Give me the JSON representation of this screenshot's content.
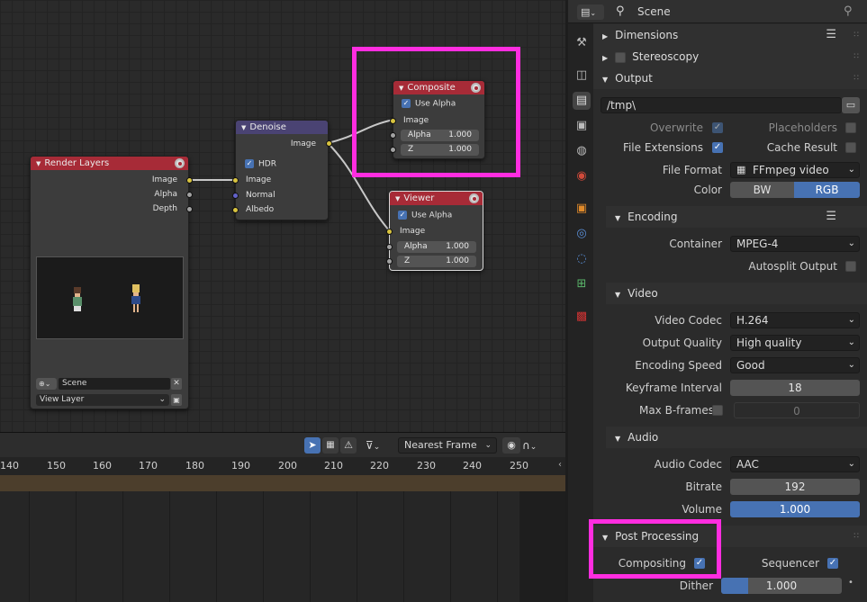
{
  "nodes": {
    "render_layers": {
      "title": "Render Layers",
      "outputs": [
        "Image",
        "Alpha",
        "Depth"
      ],
      "scene_field": "Scene",
      "layer_field": "View Layer"
    },
    "denoise": {
      "title": "Denoise",
      "output": "Image",
      "hdr_label": "HDR",
      "inputs": [
        "Image",
        "Normal",
        "Albedo"
      ]
    },
    "composite": {
      "title": "Composite",
      "use_alpha": "Use Alpha",
      "image": "Image",
      "alpha_label": "Alpha",
      "alpha_value": "1.000",
      "z_label": "Z",
      "z_value": "1.000"
    },
    "viewer": {
      "title": "Viewer",
      "use_alpha": "Use Alpha",
      "image": "Image",
      "alpha_label": "Alpha",
      "alpha_value": "1.000",
      "z_label": "Z",
      "z_value": "1.000"
    }
  },
  "timeline": {
    "interpolation": "Nearest Frame",
    "ticks": [
      "140",
      "150",
      "160",
      "170",
      "180",
      "190",
      "200",
      "210",
      "220",
      "230",
      "240",
      "250"
    ]
  },
  "properties": {
    "header_title": "Scene",
    "sections": {
      "dimensions": "Dimensions",
      "stereoscopy": "Stereoscopy",
      "output": "Output",
      "encoding": "Encoding",
      "video": "Video",
      "audio": "Audio",
      "post_processing": "Post Processing"
    },
    "output": {
      "path": "/tmp\\",
      "overwrite": "Overwrite",
      "placeholders": "Placeholders",
      "file_extensions": "File Extensions",
      "cache_result": "Cache Result",
      "file_format_label": "File Format",
      "file_format": "FFmpeg video",
      "color_label": "Color",
      "color_bw": "BW",
      "color_rgb": "RGB"
    },
    "encoding": {
      "container_label": "Container",
      "container": "MPEG-4",
      "autosplit": "Autosplit Output"
    },
    "video": {
      "codec_label": "Video Codec",
      "codec": "H.264",
      "quality_label": "Output Quality",
      "quality": "High quality",
      "speed_label": "Encoding Speed",
      "speed": "Good",
      "keyframe_label": "Keyframe Interval",
      "keyframe": "18",
      "bframes_label": "Max B-frames",
      "bframes": "0"
    },
    "audio": {
      "codec_label": "Audio Codec",
      "codec": "AAC",
      "bitrate_label": "Bitrate",
      "bitrate": "192",
      "volume_label": "Volume",
      "volume": "1.000"
    },
    "post": {
      "compositing": "Compositing",
      "sequencer": "Sequencer",
      "dither_label": "Dither",
      "dither": "1.000"
    }
  },
  "colors": {
    "highlight": "#ff2de0",
    "accent": "#4772b3",
    "node_output_header": "#a72b37",
    "node_filter_header": "#4a4373"
  }
}
